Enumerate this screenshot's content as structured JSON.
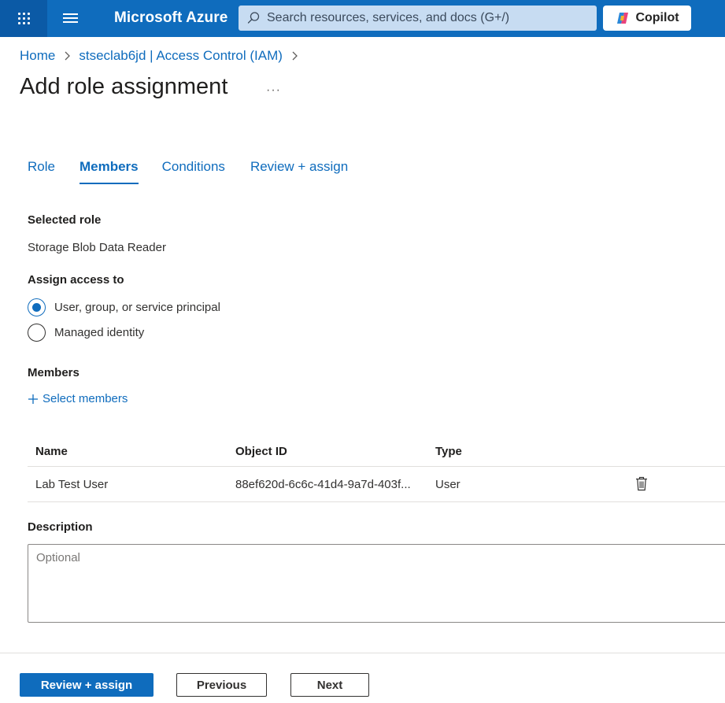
{
  "header": {
    "brand": "Microsoft Azure",
    "search_placeholder": "Search resources, services, and docs (G+/)",
    "copilot_label": "Copilot"
  },
  "breadcrumb": {
    "items": [
      "Home",
      "stseclab6jd | Access Control (IAM)"
    ]
  },
  "page": {
    "title": "Add role assignment",
    "more": "···"
  },
  "tabs": [
    {
      "label": "Role",
      "active": false
    },
    {
      "label": "Members",
      "active": true
    },
    {
      "label": "Conditions",
      "active": false
    },
    {
      "label": "Review + assign",
      "active": false
    }
  ],
  "selected_role": {
    "label": "Selected role",
    "value": "Storage Blob Data Reader"
  },
  "assign_access": {
    "label": "Assign access to",
    "options": [
      {
        "label": "User, group, or service principal",
        "checked": true
      },
      {
        "label": "Managed identity",
        "checked": false
      }
    ]
  },
  "members": {
    "label": "Members",
    "select_label": "Select members",
    "columns": [
      "Name",
      "Object ID",
      "Type"
    ],
    "rows": [
      {
        "name": "Lab Test User",
        "object_id": "88ef620d-6c6c-41d4-9a7d-403f...",
        "type": "User"
      }
    ]
  },
  "description": {
    "label": "Description",
    "placeholder": "Optional"
  },
  "footer": {
    "review_assign": "Review + assign",
    "previous": "Previous",
    "next": "Next"
  },
  "colors": {
    "accent": "#0f6cbd",
    "topbar": "#0f6cbd"
  }
}
